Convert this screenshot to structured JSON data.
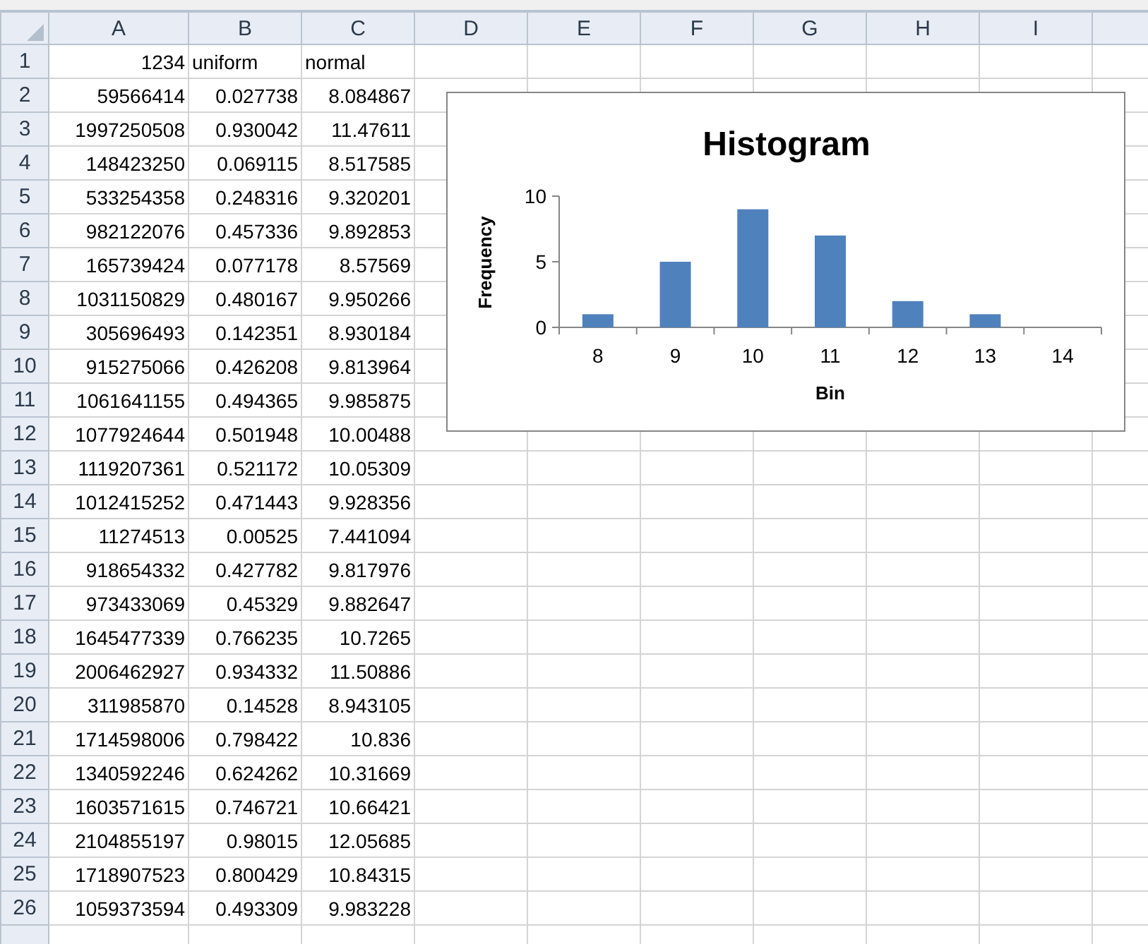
{
  "columns": [
    "A",
    "B",
    "C",
    "D",
    "E",
    "F",
    "G",
    "H",
    "I"
  ],
  "rows": [
    {
      "header": "1",
      "cells": [
        {
          "value": "1234",
          "kind": "number"
        },
        {
          "value": "uniform",
          "kind": "text"
        },
        {
          "value": "normal",
          "kind": "text"
        }
      ]
    },
    {
      "header": "2",
      "cells": [
        {
          "value": "59566414",
          "kind": "number"
        },
        {
          "value": "0.027738",
          "kind": "number"
        },
        {
          "value": "8.084867",
          "kind": "number"
        }
      ]
    },
    {
      "header": "3",
      "cells": [
        {
          "value": "1997250508",
          "kind": "number"
        },
        {
          "value": "0.930042",
          "kind": "number"
        },
        {
          "value": "11.47611",
          "kind": "number"
        }
      ]
    },
    {
      "header": "4",
      "cells": [
        {
          "value": "148423250",
          "kind": "number"
        },
        {
          "value": "0.069115",
          "kind": "number"
        },
        {
          "value": "8.517585",
          "kind": "number"
        }
      ]
    },
    {
      "header": "5",
      "cells": [
        {
          "value": "533254358",
          "kind": "number"
        },
        {
          "value": "0.248316",
          "kind": "number"
        },
        {
          "value": "9.320201",
          "kind": "number"
        }
      ]
    },
    {
      "header": "6",
      "cells": [
        {
          "value": "982122076",
          "kind": "number"
        },
        {
          "value": "0.457336",
          "kind": "number"
        },
        {
          "value": "9.892853",
          "kind": "number"
        }
      ]
    },
    {
      "header": "7",
      "cells": [
        {
          "value": "165739424",
          "kind": "number"
        },
        {
          "value": "0.077178",
          "kind": "number"
        },
        {
          "value": "8.57569",
          "kind": "number"
        }
      ]
    },
    {
      "header": "8",
      "cells": [
        {
          "value": "1031150829",
          "kind": "number"
        },
        {
          "value": "0.480167",
          "kind": "number"
        },
        {
          "value": "9.950266",
          "kind": "number"
        }
      ]
    },
    {
      "header": "9",
      "cells": [
        {
          "value": "305696493",
          "kind": "number"
        },
        {
          "value": "0.142351",
          "kind": "number"
        },
        {
          "value": "8.930184",
          "kind": "number"
        }
      ]
    },
    {
      "header": "10",
      "cells": [
        {
          "value": "915275066",
          "kind": "number"
        },
        {
          "value": "0.426208",
          "kind": "number"
        },
        {
          "value": "9.813964",
          "kind": "number"
        }
      ]
    },
    {
      "header": "11",
      "cells": [
        {
          "value": "1061641155",
          "kind": "number"
        },
        {
          "value": "0.494365",
          "kind": "number"
        },
        {
          "value": "9.985875",
          "kind": "number"
        }
      ]
    },
    {
      "header": "12",
      "cells": [
        {
          "value": "1077924644",
          "kind": "number"
        },
        {
          "value": "0.501948",
          "kind": "number"
        },
        {
          "value": "10.00488",
          "kind": "number"
        }
      ]
    },
    {
      "header": "13",
      "cells": [
        {
          "value": "1119207361",
          "kind": "number"
        },
        {
          "value": "0.521172",
          "kind": "number"
        },
        {
          "value": "10.05309",
          "kind": "number"
        }
      ]
    },
    {
      "header": "14",
      "cells": [
        {
          "value": "1012415252",
          "kind": "number"
        },
        {
          "value": "0.471443",
          "kind": "number"
        },
        {
          "value": "9.928356",
          "kind": "number"
        }
      ]
    },
    {
      "header": "15",
      "cells": [
        {
          "value": "11274513",
          "kind": "number"
        },
        {
          "value": "0.00525",
          "kind": "number"
        },
        {
          "value": "7.441094",
          "kind": "number"
        }
      ]
    },
    {
      "header": "16",
      "cells": [
        {
          "value": "918654332",
          "kind": "number"
        },
        {
          "value": "0.427782",
          "kind": "number"
        },
        {
          "value": "9.817976",
          "kind": "number"
        }
      ]
    },
    {
      "header": "17",
      "cells": [
        {
          "value": "973433069",
          "kind": "number"
        },
        {
          "value": "0.45329",
          "kind": "number"
        },
        {
          "value": "9.882647",
          "kind": "number"
        }
      ]
    },
    {
      "header": "18",
      "cells": [
        {
          "value": "1645477339",
          "kind": "number"
        },
        {
          "value": "0.766235",
          "kind": "number"
        },
        {
          "value": "10.7265",
          "kind": "number"
        }
      ]
    },
    {
      "header": "19",
      "cells": [
        {
          "value": "2006462927",
          "kind": "number"
        },
        {
          "value": "0.934332",
          "kind": "number"
        },
        {
          "value": "11.50886",
          "kind": "number"
        }
      ]
    },
    {
      "header": "20",
      "cells": [
        {
          "value": "311985870",
          "kind": "number"
        },
        {
          "value": "0.14528",
          "kind": "number"
        },
        {
          "value": "8.943105",
          "kind": "number"
        }
      ]
    },
    {
      "header": "21",
      "cells": [
        {
          "value": "1714598006",
          "kind": "number"
        },
        {
          "value": "0.798422",
          "kind": "number"
        },
        {
          "value": "10.836",
          "kind": "number"
        }
      ]
    },
    {
      "header": "22",
      "cells": [
        {
          "value": "1340592246",
          "kind": "number"
        },
        {
          "value": "0.624262",
          "kind": "number"
        },
        {
          "value": "10.31669",
          "kind": "number"
        }
      ]
    },
    {
      "header": "23",
      "cells": [
        {
          "value": "1603571615",
          "kind": "number"
        },
        {
          "value": "0.746721",
          "kind": "number"
        },
        {
          "value": "10.66421",
          "kind": "number"
        }
      ]
    },
    {
      "header": "24",
      "cells": [
        {
          "value": "2104855197",
          "kind": "number"
        },
        {
          "value": "0.98015",
          "kind": "number"
        },
        {
          "value": "12.05685",
          "kind": "number"
        }
      ]
    },
    {
      "header": "25",
      "cells": [
        {
          "value": "1718907523",
          "kind": "number"
        },
        {
          "value": "0.800429",
          "kind": "number"
        },
        {
          "value": "10.84315",
          "kind": "number"
        }
      ]
    },
    {
      "header": "26",
      "cells": [
        {
          "value": "1059373594",
          "kind": "number"
        },
        {
          "value": "0.493309",
          "kind": "number"
        },
        {
          "value": "9.983228",
          "kind": "number"
        }
      ]
    }
  ],
  "chart": {
    "chart_data": {
      "type": "bar",
      "title": "Histogram",
      "xlabel": "Bin",
      "ylabel": "Frequency",
      "categories": [
        "8",
        "9",
        "10",
        "11",
        "12",
        "13",
        "14"
      ],
      "series": [
        {
          "color": "#4f81bd",
          "values": [
            1,
            5,
            9,
            7,
            2,
            1,
            0
          ]
        }
      ],
      "ylim": [
        0,
        10
      ],
      "yticks": [
        0,
        5,
        10
      ]
    }
  }
}
